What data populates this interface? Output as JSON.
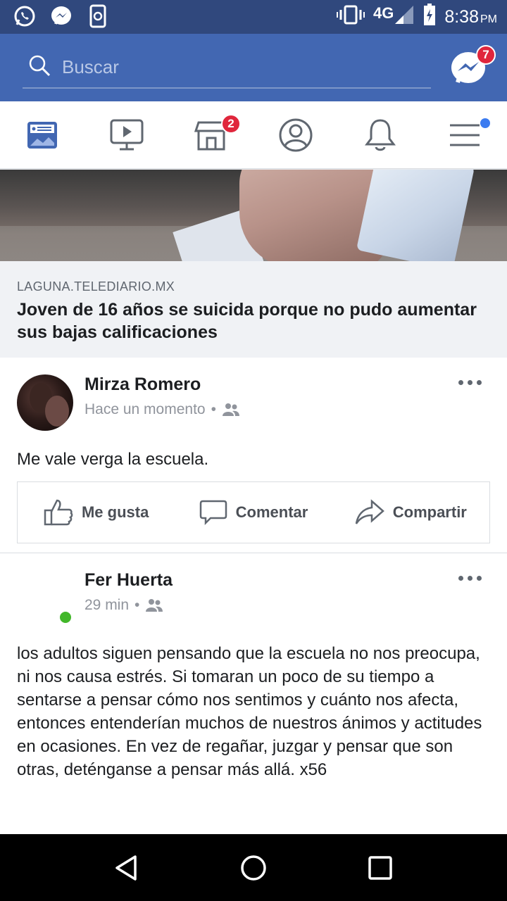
{
  "status_bar": {
    "time": "8:38",
    "ampm": "PM",
    "network": "4G",
    "icons": [
      "whatsapp-icon",
      "messenger-icon",
      "phone-sync-icon",
      "vibrate-icon",
      "signal-icon",
      "battery-charging-icon"
    ]
  },
  "header": {
    "search_placeholder": "Buscar",
    "messenger_badge": "7"
  },
  "tabs": [
    {
      "name": "news-feed",
      "icon": "news-feed-icon",
      "active": true
    },
    {
      "name": "watch",
      "icon": "video-icon"
    },
    {
      "name": "marketplace",
      "icon": "marketplace-icon",
      "badge": "2"
    },
    {
      "name": "profile",
      "icon": "profile-icon"
    },
    {
      "name": "notifications",
      "icon": "bell-icon"
    },
    {
      "name": "menu",
      "icon": "menu-icon",
      "dot": true
    }
  ],
  "link_card": {
    "domain": "LAGUNA.TELEDIARIO.MX",
    "title": "Joven de 16 años se suicida porque no pudo aumentar sus bajas calificaciones"
  },
  "posts": [
    {
      "author": "Mirza Romero",
      "time": "Hace un momento",
      "audience_icon": "friends-icon",
      "text": "Me vale verga la escuela.",
      "actions": {
        "like": "Me gusta",
        "comment": "Comentar",
        "share": "Compartir"
      }
    },
    {
      "author": "Fer Huerta",
      "time": "29 min",
      "audience_icon": "friends-icon",
      "online": true,
      "text": "los adultos siguen pensando que la escuela no nos preocupa, ni nos causa estrés. Si tomaran un poco de su tiempo a sentarse a pensar cómo nos sentimos y cuánto nos afecta, entonces entenderían muchos de nuestros ánimos y actitudes en ocasiones. En vez de regañar, juzgar y pensar que son otras, deténganse a pensar más allá. x56"
    }
  ],
  "colors": {
    "status_bar": "#30487d",
    "header": "#4267b2",
    "badge": "#e0263c",
    "online": "#42b72a"
  }
}
